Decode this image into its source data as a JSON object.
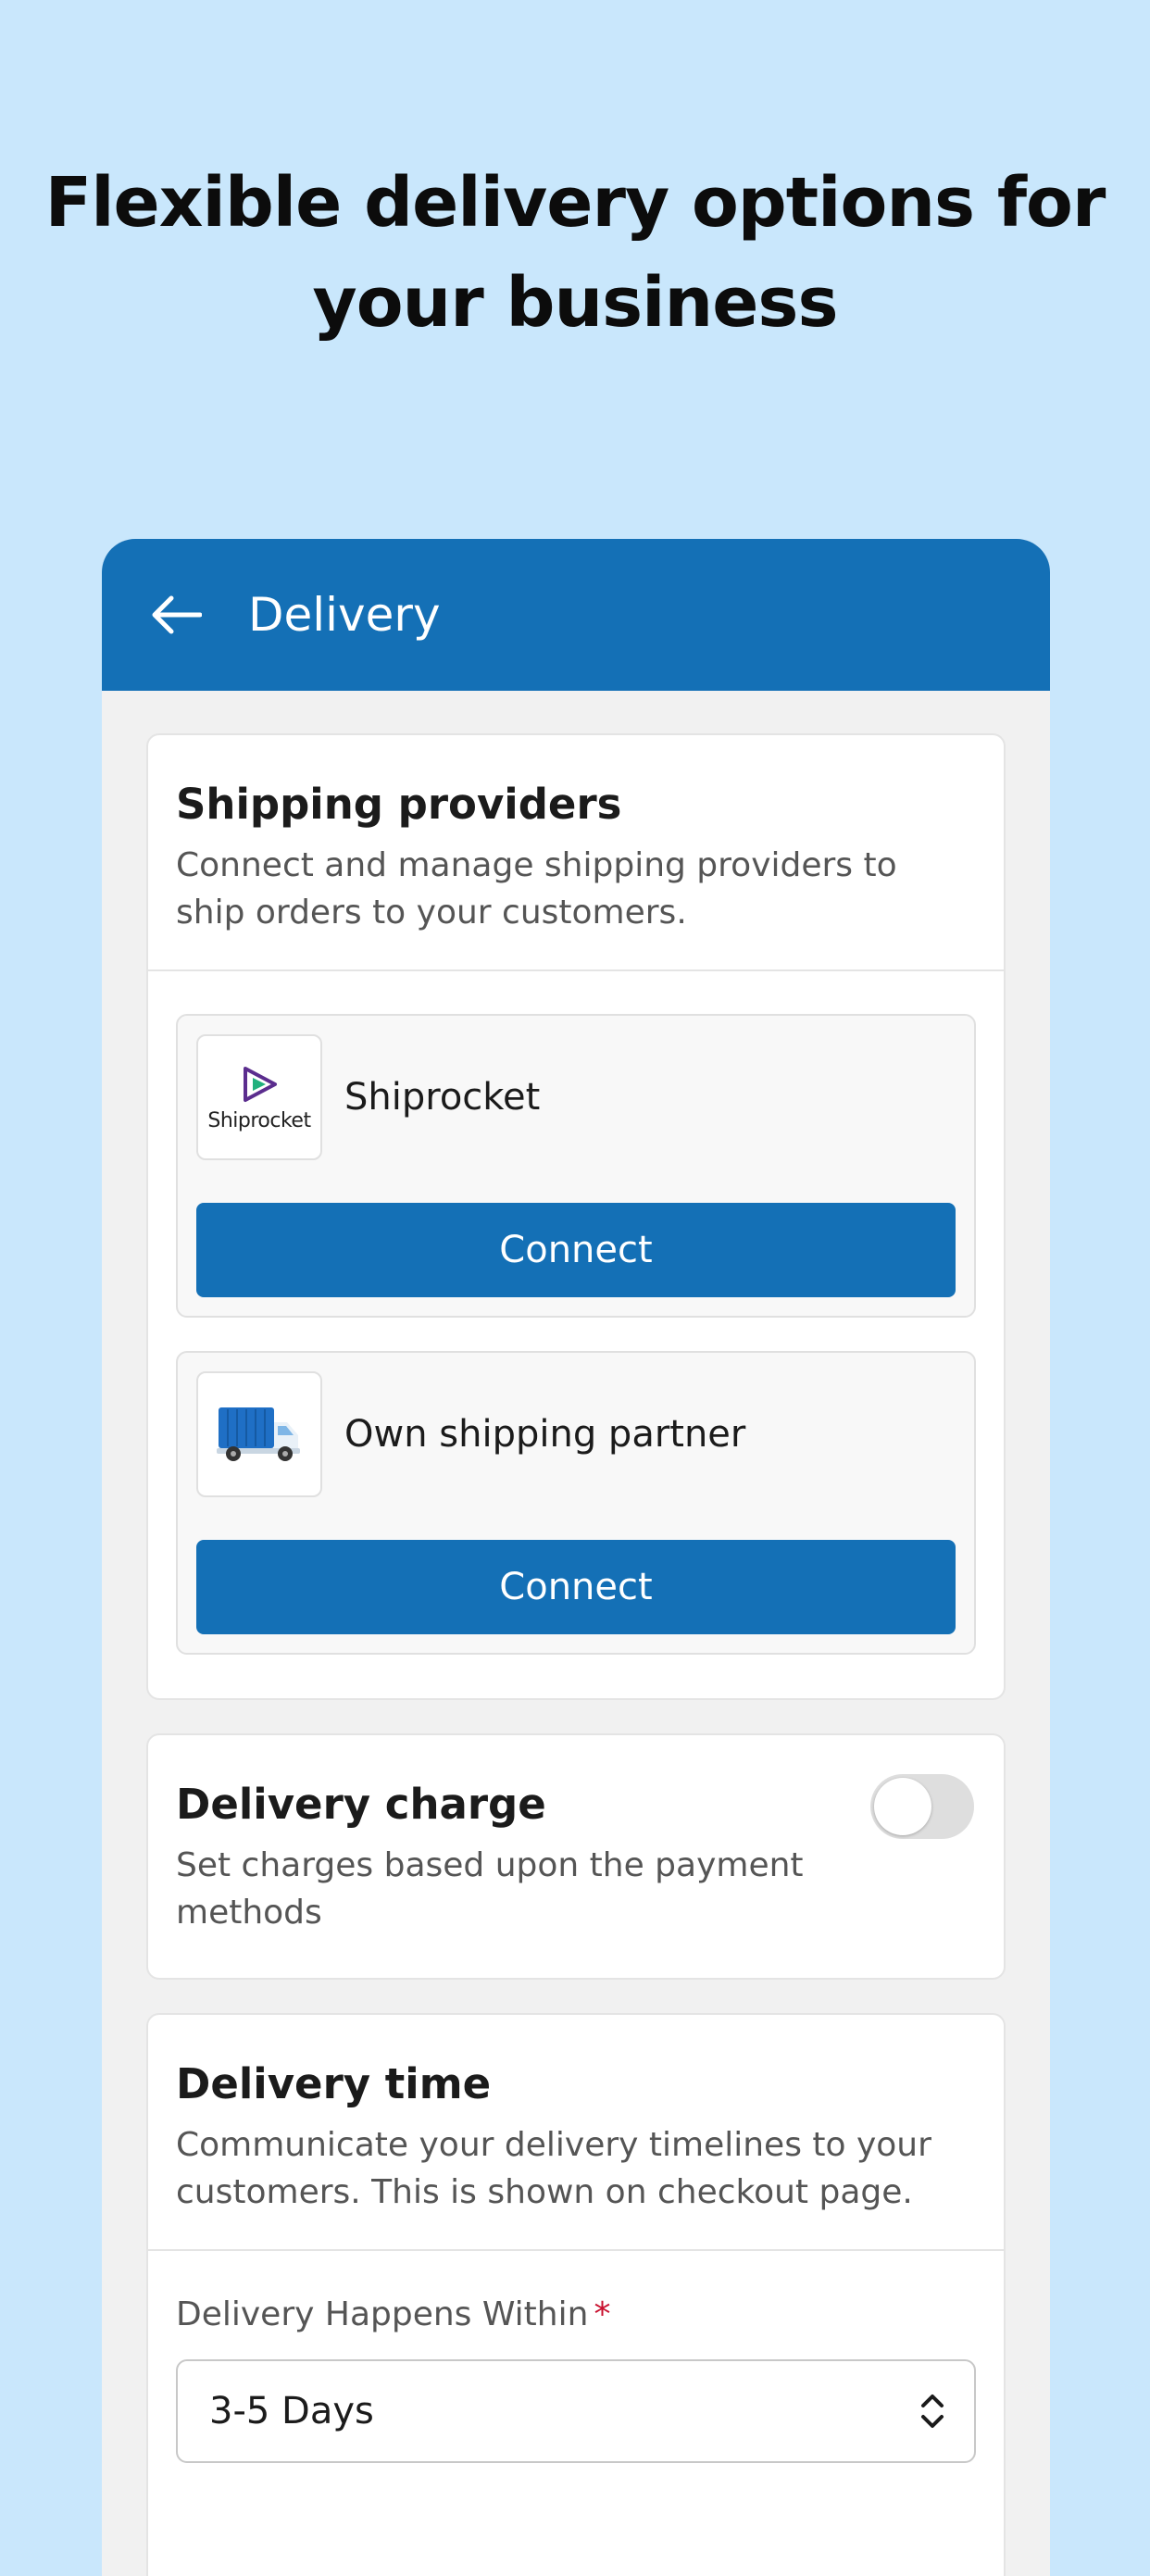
{
  "headline": {
    "line1": "Flexible delivery options for",
    "line2": "your business"
  },
  "appbar": {
    "title": "Delivery",
    "back_icon": "arrow-left-icon"
  },
  "shipping": {
    "title": "Shipping providers",
    "description": "Connect and manage shipping providers to ship orders to your customers.",
    "providers": [
      {
        "name": "Shiprocket",
        "logo_text": "Shiprocket",
        "logo_icon": "shiprocket-logo-icon",
        "button_label": "Connect"
      },
      {
        "name": "Own shipping partner",
        "logo_icon": "delivery-truck-icon",
        "button_label": "Connect"
      }
    ]
  },
  "delivery_charge": {
    "title": "Delivery charge",
    "description": "Set charges based upon the payment methods",
    "toggle_on": false
  },
  "delivery_time": {
    "title": "Delivery time",
    "description": "Communicate your delivery timelines to your customers. This is shown on checkout page.",
    "field_label": "Delivery Happens Within",
    "required_mark": "*",
    "selected_value": "3-5 Days",
    "select_icon": "chevron-up-down-icon"
  },
  "colors": {
    "background": "#c9e7fc",
    "brand": "#1470b6",
    "required": "#c8102e",
    "shiprocket_purple": "#5b2d8e"
  }
}
